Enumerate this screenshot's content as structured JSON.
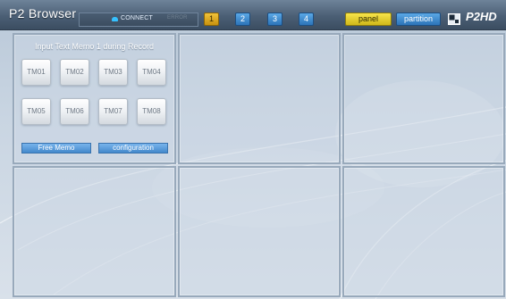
{
  "app": {
    "title": "P2 Browser",
    "connect_label": "CONNECT",
    "error_label": "ERROR",
    "page_buttons": [
      "1",
      "2",
      "3",
      "4"
    ],
    "active_page": "1",
    "panel_label": "panel",
    "partition_label": "partition",
    "logo_text": "P2HD"
  },
  "memo_panel": {
    "title": "Input Text Memo 1 during Record",
    "memo_buttons": [
      "TM01",
      "TM02",
      "TM03",
      "TM04",
      "TM05",
      "TM06",
      "TM07",
      "TM08"
    ],
    "free_memo_label": "Free Memo",
    "configuration_label": "configuration"
  },
  "colors": {
    "topbar": "#4b5f75",
    "active_page": "#e0ab1f",
    "page_button": "#3e8ed2",
    "panel_button": "#e6d232",
    "partition_button": "#3e8ed2",
    "memo_button": "#eef1f4",
    "accent_connect": "#36c1ff"
  },
  "icons": [
    "connect-status-icon",
    "window-toggle-icon",
    "p2hd-logo"
  ]
}
